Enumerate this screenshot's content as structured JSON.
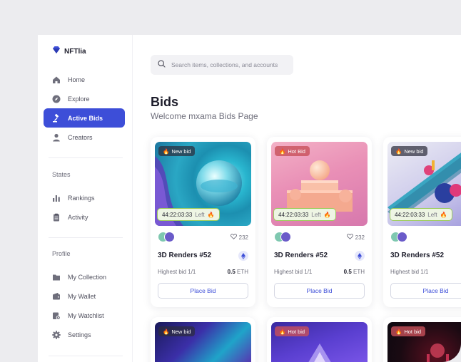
{
  "brand": {
    "name": "NFTlia"
  },
  "search": {
    "placeholder": "Search items, collections, and accounts"
  },
  "sidebar": {
    "main_items": [
      {
        "label": "Home",
        "icon": "home-icon"
      },
      {
        "label": "Explore",
        "icon": "compass-icon"
      },
      {
        "label": "Active Bids",
        "icon": "gavel-icon",
        "active": true
      },
      {
        "label": "Creators",
        "icon": "user-icon"
      }
    ],
    "states_label": "States",
    "states_items": [
      {
        "label": "Rankings",
        "icon": "bar-chart-icon"
      },
      {
        "label": "Activity",
        "icon": "clipboard-icon"
      }
    ],
    "profile_label": "Profile",
    "profile_items": [
      {
        "label": "My Collection",
        "icon": "folder-icon"
      },
      {
        "label": "My Wallet",
        "icon": "wallet-icon"
      },
      {
        "label": "My Watchlist",
        "icon": "watchlist-icon"
      },
      {
        "label": "Settings",
        "icon": "gear-icon"
      }
    ]
  },
  "page": {
    "title": "Bids",
    "subtitle": "Welcome mxama Bids Page"
  },
  "cards": [
    {
      "badge": "New bid",
      "badge_type": "dark",
      "timer": "44:22:03:33",
      "timer_suffix": "Left",
      "likes": "232",
      "title": "3D Renders #52",
      "bid_label": "Highest bid 1/1",
      "bid_amount": "0.5",
      "bid_currency": "ETH",
      "button": "Place Bid"
    },
    {
      "badge": "Hot Bid",
      "badge_type": "hot",
      "timer": "44:22:03:33",
      "timer_suffix": "Left",
      "likes": "232",
      "title": "3D Renders #52",
      "bid_label": "Highest bid 1/1",
      "bid_amount": "0.5",
      "bid_currency": "ETH",
      "button": "Place Bid"
    },
    {
      "badge": "New bid",
      "badge_type": "dark",
      "timer": "44:22:03:33",
      "timer_suffix": "Left",
      "likes": "",
      "title": "3D Renders #52",
      "bid_label": "Highest bid 1/1",
      "bid_amount": "",
      "bid_currency": "",
      "button": "Place Bid"
    }
  ],
  "cards_row2": [
    {
      "badge": "New bid",
      "badge_type": "dark"
    },
    {
      "badge": "Hot bid",
      "badge_type": "hot"
    },
    {
      "badge": "Hot bid",
      "badge_type": "hot"
    }
  ],
  "colors": {
    "accent": "#3d4ed8",
    "timer_border": "#9ccc5c",
    "hot_badge": "#c8505a"
  }
}
